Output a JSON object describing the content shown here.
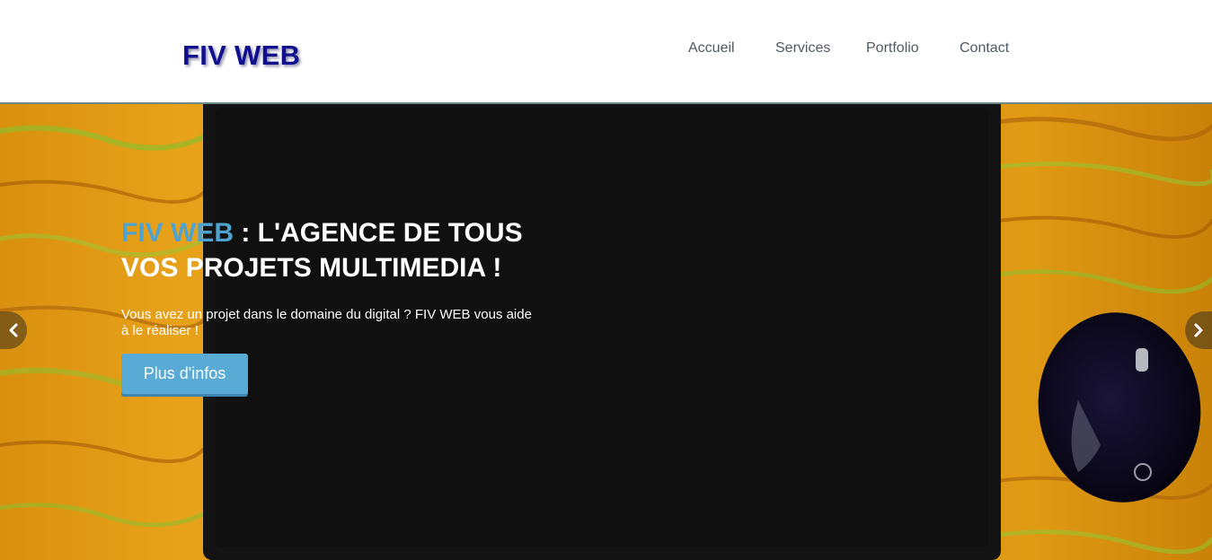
{
  "brand": {
    "name": "FIV WEB"
  },
  "nav": {
    "items": [
      {
        "label": "Accueil"
      },
      {
        "label": "Services"
      },
      {
        "label": "Portfolio"
      },
      {
        "label": "Contact"
      }
    ]
  },
  "hero": {
    "title_accent": "FIV WEB",
    "title_rest": " : L'AGENCE DE TOUS VOS PROJETS MULTIMEDIA !",
    "text": "Vous avez un projet dans le domaine du digital ? FIV WEB vous aide à le réaliser !",
    "button_label": "Plus d'infos"
  },
  "colors": {
    "brand": "#10108f",
    "accent": "#4fa3d1",
    "button": "#5aaad6",
    "nav_text": "#505a64"
  },
  "icons": {
    "prev": "chevron-left-icon",
    "next": "chevron-right-icon"
  }
}
